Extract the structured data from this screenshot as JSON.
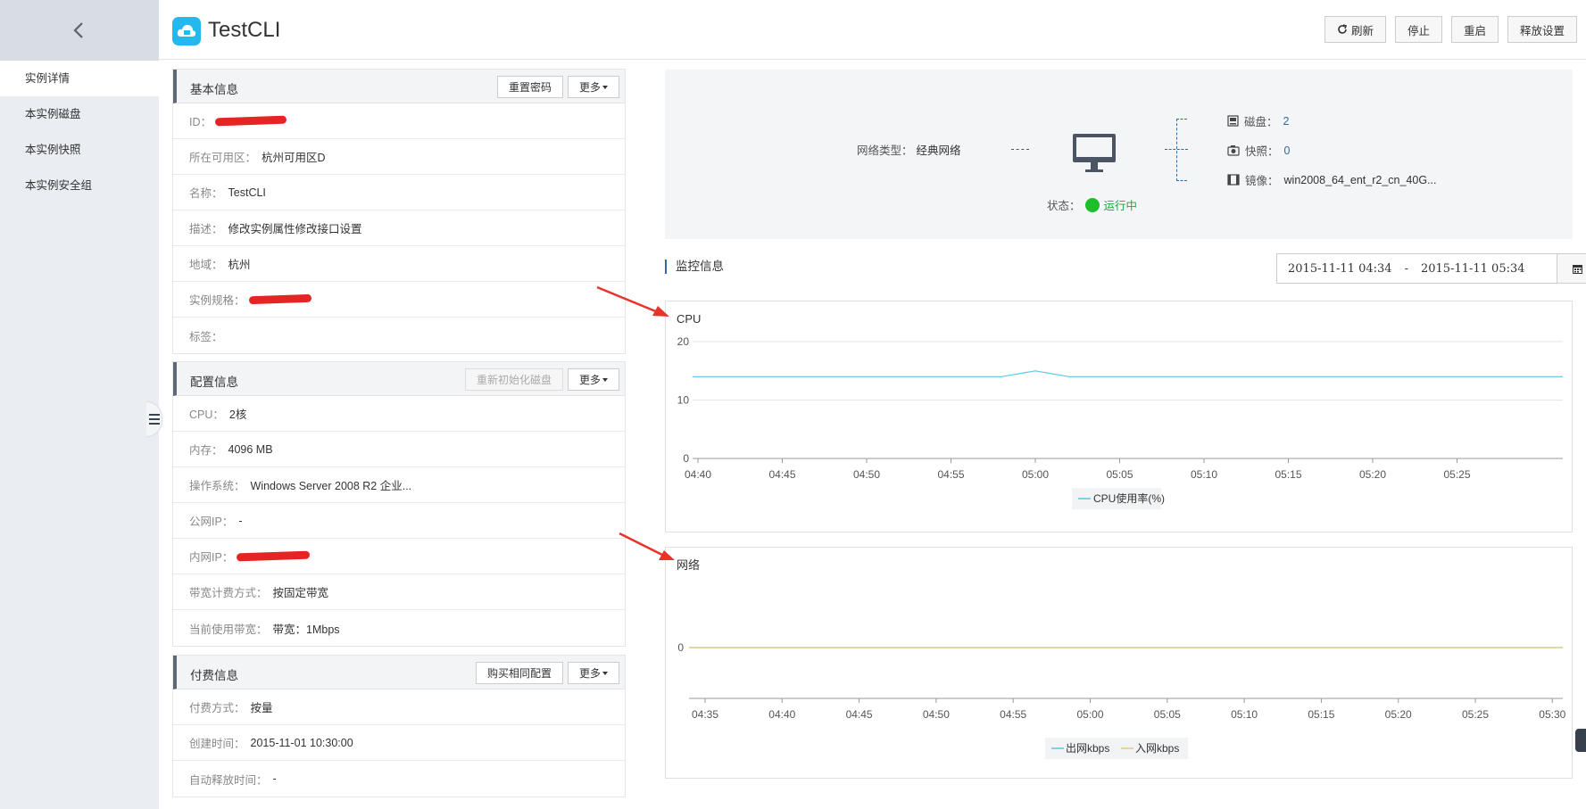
{
  "sidebar": {
    "items": [
      {
        "label": "实例详情",
        "active": true
      },
      {
        "label": "本实例磁盘"
      },
      {
        "label": "本实例快照"
      },
      {
        "label": "本实例安全组"
      }
    ]
  },
  "header": {
    "title": "TestCLI",
    "buttons": {
      "refresh": "刷新",
      "stop": "停止",
      "restart": "重启",
      "release": "释放设置"
    }
  },
  "basic": {
    "title": "基本信息",
    "reset_pwd": "重置密码",
    "more": "更多",
    "id_label": "ID：",
    "zone_label": "所在可用区：",
    "zone": "杭州可用区D",
    "name_label": "名称：",
    "name": "TestCLI",
    "desc_label": "描述：",
    "desc": "修改实例属性修改接口设置",
    "region_label": "地域：",
    "region": "杭州",
    "spec_label": "实例规格：",
    "tag_label": "标签："
  },
  "config": {
    "title": "配置信息",
    "reinit": "重新初始化磁盘",
    "more": "更多",
    "cpu_label": "CPU：",
    "cpu": "2核",
    "mem_label": "内存：",
    "mem": "4096 MB",
    "os_label": "操作系统：",
    "os": "Windows Server 2008 R2 企业...",
    "pub_ip_label": "公网IP：",
    "pub_ip": "-",
    "priv_ip_label": "内网IP：",
    "bw_billing_label": "带宽计费方式：",
    "bw_billing": "按固定带宽",
    "bw_label": "当前使用带宽：",
    "bw": "带宽：1Mbps"
  },
  "billing": {
    "title": "付费信息",
    "buy_same": "购买相同配置",
    "more": "更多",
    "method_label": "付费方式：",
    "method": "按量",
    "created_label": "创建时间：",
    "created": "2015-11-01 10:30:00",
    "auto_release_label": "自动释放时间：",
    "auto_release": "-"
  },
  "topology": {
    "net_label": "网络类型：",
    "net": "经典网络",
    "disk_label": "磁盘：",
    "disk": "2",
    "snap_label": "快照：",
    "snap": "0",
    "image_label": "镜像：",
    "image": "win2008_64_ent_r2_cn_40G...",
    "status_label": "状态：",
    "status": "运行中"
  },
  "monitor": {
    "title": "监控信息",
    "start": "2015-11-11 04:34",
    "sep": "-",
    "end": "2015-11-11 05:34"
  },
  "colors": {
    "cpu_line": "#5bc6e8",
    "net_out": "#5bc6e8",
    "net_in": "#e3c97a",
    "status_green": "#1cbe2a",
    "arrow": "#e8322b"
  },
  "chart_data": [
    {
      "type": "line",
      "title": "CPU",
      "categories": [
        "04:40",
        "04:45",
        "04:50",
        "04:55",
        "05:00",
        "05:05",
        "05:10",
        "05:15",
        "05:20",
        "05:25"
      ],
      "yticks": [
        0,
        10,
        20
      ],
      "ylim": [
        0,
        20
      ],
      "series": [
        {
          "name": "CPU使用率(%)",
          "x": [
            "04:36",
            "04:40",
            "04:45",
            "04:50",
            "04:55",
            "04:58",
            "05:00",
            "05:02",
            "05:05",
            "05:10",
            "05:15",
            "05:20",
            "05:25",
            "05:27"
          ],
          "values": [
            14,
            14,
            14,
            14,
            14,
            14,
            15,
            14,
            14,
            14,
            14,
            14,
            14,
            14
          ]
        }
      ],
      "legend": "bottom"
    },
    {
      "type": "line",
      "title": "网络",
      "categories": [
        "04:35",
        "04:40",
        "04:45",
        "04:50",
        "04:55",
        "05:00",
        "05:05",
        "05:10",
        "05:15",
        "05:20",
        "05:25",
        "05:30"
      ],
      "yticks": [
        0
      ],
      "ylim": [
        0,
        1
      ],
      "series": [
        {
          "name": "出网kbps",
          "values": [
            0,
            0,
            0,
            0,
            0,
            0,
            0,
            0,
            0,
            0,
            0,
            0
          ]
        },
        {
          "name": "入网kbps",
          "values": [
            0,
            0,
            0,
            0,
            0,
            0,
            0,
            0,
            0,
            0,
            0,
            0
          ]
        }
      ],
      "legend": "bottom"
    }
  ]
}
